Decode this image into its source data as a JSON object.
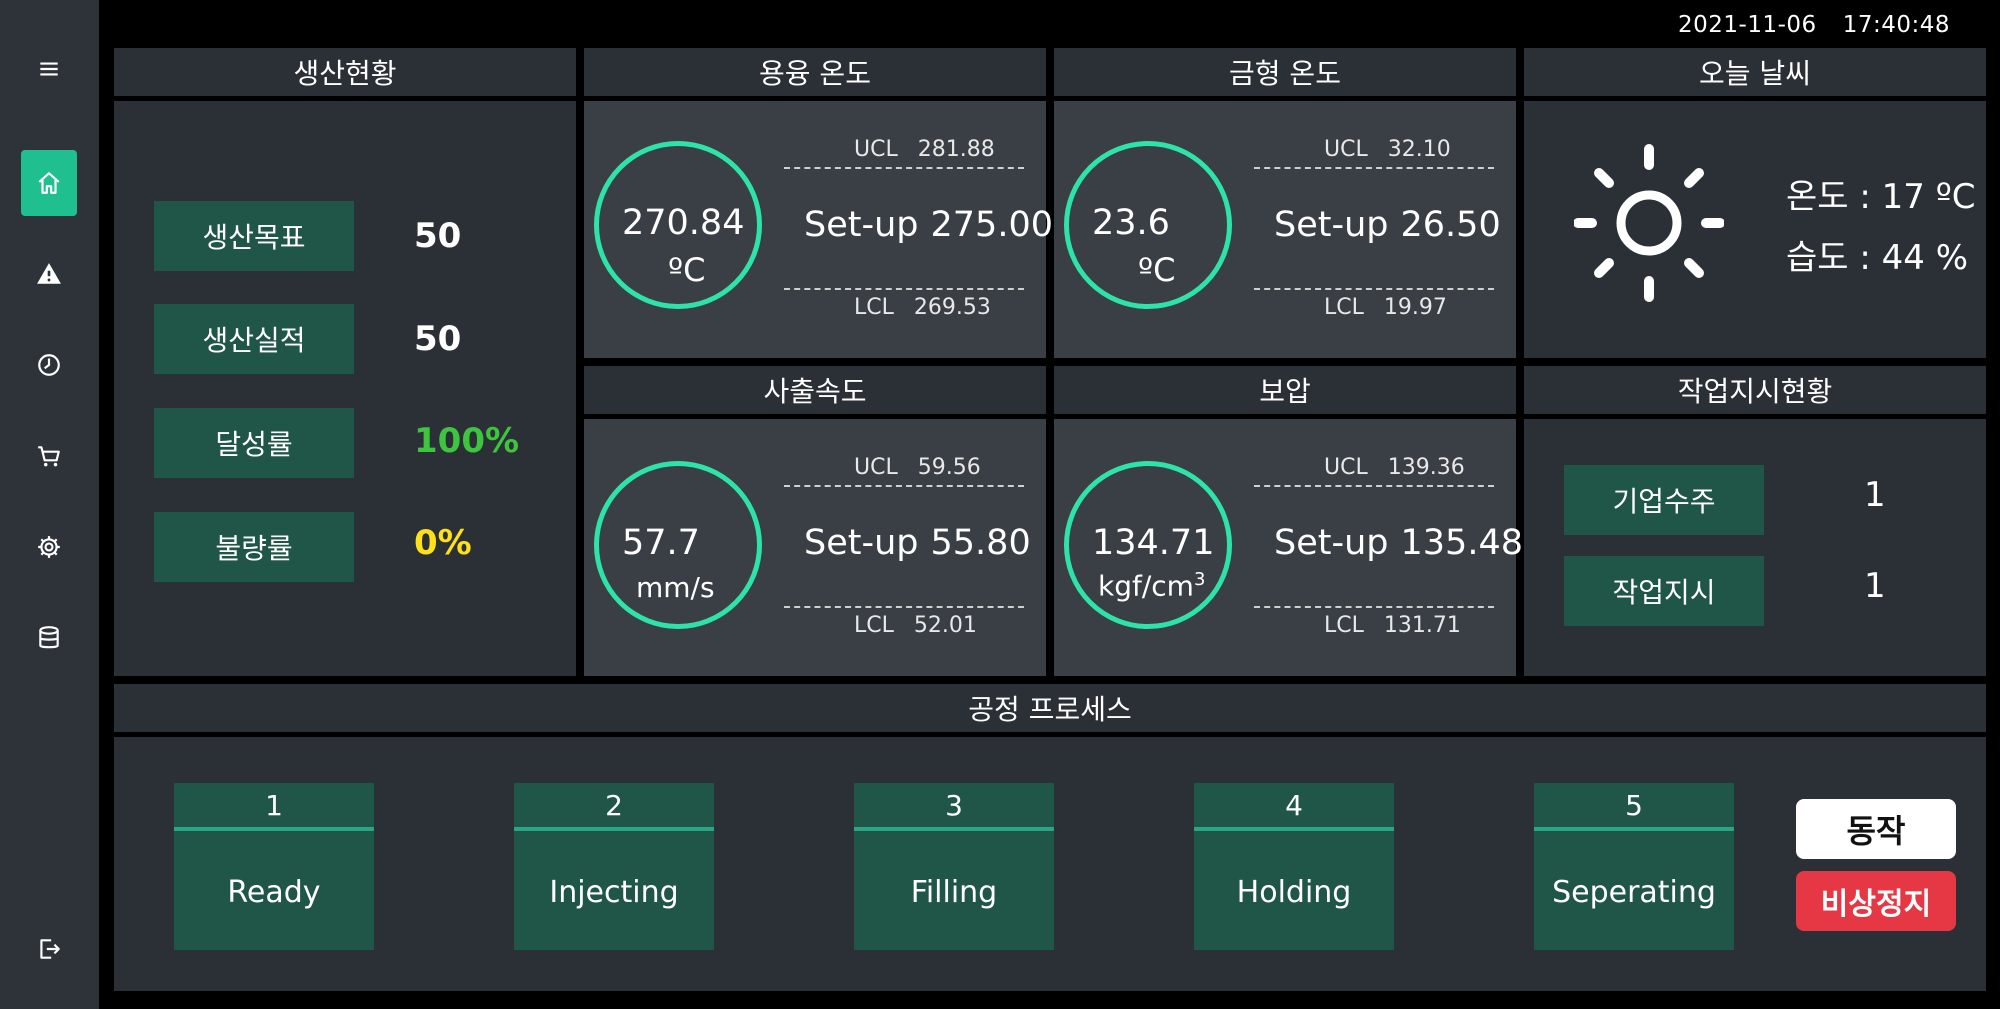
{
  "status": {
    "date": "2021-11-06",
    "time": "17:40:48"
  },
  "sidebar": {
    "items": [
      {
        "icon": "menu-icon"
      },
      {
        "icon": "home-icon",
        "active": true
      },
      {
        "icon": "alert-icon"
      },
      {
        "icon": "clock-icon"
      },
      {
        "icon": "cart-icon"
      },
      {
        "icon": "gear-icon"
      },
      {
        "icon": "database-icon"
      },
      {
        "icon": "logout-icon"
      }
    ]
  },
  "production": {
    "title": "생산현황",
    "rows": [
      {
        "label": "생산목표",
        "value": "50",
        "color": "#ffffff"
      },
      {
        "label": "생산실적",
        "value": "50",
        "color": "#ffffff"
      },
      {
        "label": "달성률",
        "value": "100%",
        "color": "#3ec43e"
      },
      {
        "label": "불량률",
        "value": "0%",
        "color": "#ffe11a"
      }
    ]
  },
  "melt_temp": {
    "title": "용융 온도",
    "value": "270.84",
    "unit": "ºC",
    "ucl_label": "UCL",
    "ucl": "281.88",
    "setup_label": "Set-up",
    "setup": "275.00",
    "lcl_label": "LCL",
    "lcl": "269.53"
  },
  "mold_temp": {
    "title": "금형 온도",
    "value": "23.6",
    "unit": "ºC",
    "ucl_label": "UCL",
    "ucl": "32.10",
    "setup_label": "Set-up",
    "setup": "26.50",
    "lcl_label": "LCL",
    "lcl": "19.97"
  },
  "injection_speed": {
    "title": "사출속도",
    "value": "57.7",
    "unit": "mm/s",
    "ucl_label": "UCL",
    "ucl": "59.56",
    "setup_label": "Set-up",
    "setup": "55.80",
    "lcl_label": "LCL",
    "lcl": "52.01"
  },
  "holding_pressure": {
    "title": "보압",
    "value": "134.71",
    "unit": "kgf/cm",
    "unit_sup": "3",
    "ucl_label": "UCL",
    "ucl": "139.36",
    "setup_label": "Set-up",
    "setup": "135.48",
    "lcl_label": "LCL",
    "lcl": "131.71"
  },
  "weather": {
    "title": "오늘 날씨",
    "icon": "sun-icon",
    "temperature": "온도 : 17 ºC",
    "humidity": "습도 : 44 %"
  },
  "work_orders": {
    "title": "작업지시현황",
    "rows": [
      {
        "label": "기업수주",
        "value": "1"
      },
      {
        "label": "작업지시",
        "value": "1"
      }
    ]
  },
  "process": {
    "title": "공정 프로세스",
    "steps": [
      {
        "num": "1",
        "label": "Ready"
      },
      {
        "num": "2",
        "label": "Injecting"
      },
      {
        "num": "3",
        "label": "Filling"
      },
      {
        "num": "4",
        "label": "Holding"
      },
      {
        "num": "5",
        "label": "Seperating"
      }
    ],
    "run_label": "동작",
    "stop_label": "비상정지"
  },
  "colors": {
    "accent": "#2de3a8",
    "panel": "#2b2f36",
    "panel_light": "#3a3e45",
    "label_bg": "#205647",
    "stop": "#e63744"
  }
}
